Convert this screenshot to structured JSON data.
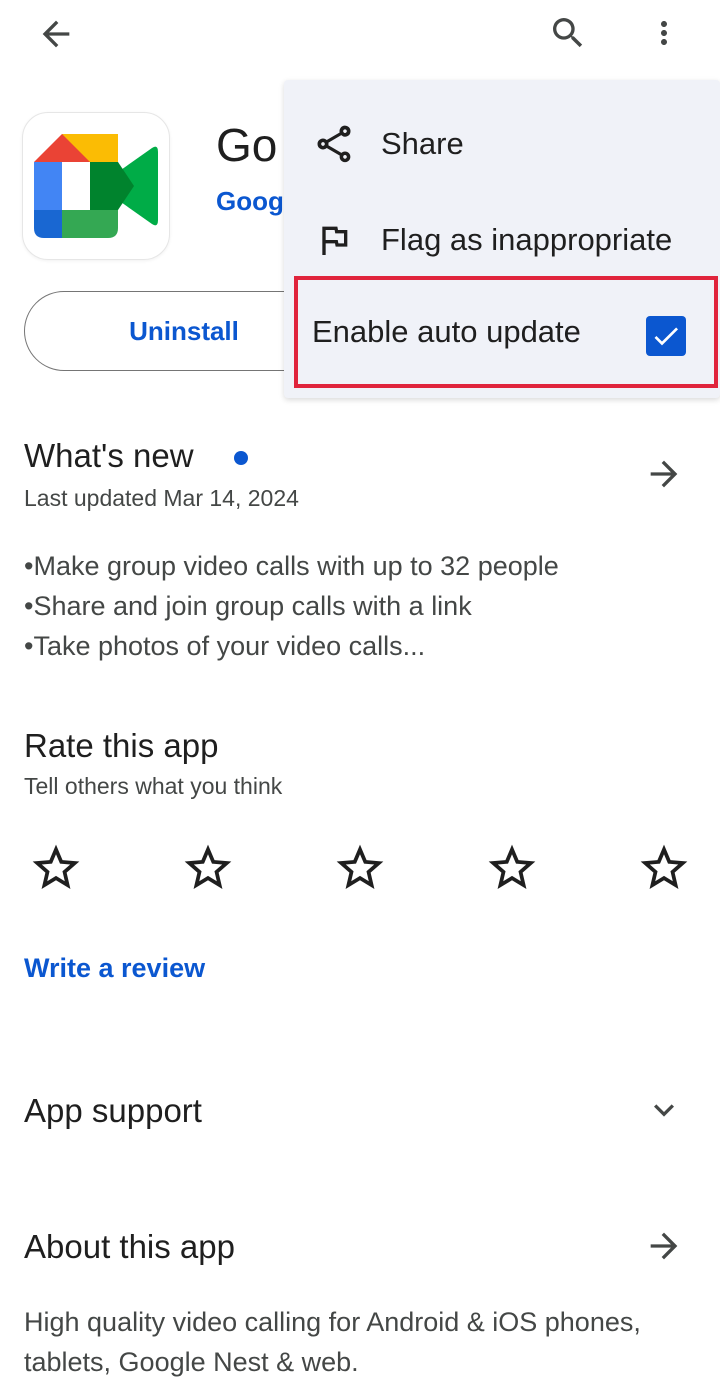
{
  "app": {
    "title": "Go",
    "developer": "Goog",
    "uninstall_label": "Uninstall"
  },
  "menu": {
    "share_label": "Share",
    "flag_label": "Flag as inappropriate",
    "auto_update_label": "Enable auto update",
    "auto_update_checked": true
  },
  "whats_new": {
    "title": "What's new",
    "subtitle": "Last updated Mar 14, 2024",
    "bullets": [
      "•Make group video calls with up to 32 people",
      "•Share and join group calls with a link",
      "•Take photos of your video calls..."
    ]
  },
  "rate": {
    "title": "Rate this app",
    "subtitle": "Tell others what you think",
    "stars": 5,
    "write_review": "Write a review"
  },
  "app_support": {
    "title": "App support"
  },
  "about": {
    "title": "About this app",
    "description": "High quality video calling for Android & iOS phones, tablets, Google Nest & web."
  },
  "colors": {
    "accent": "#0b57d0",
    "highlight_border": "#e0243c",
    "menu_bg": "#f0f2f8"
  }
}
